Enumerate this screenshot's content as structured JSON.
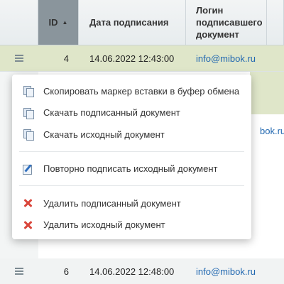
{
  "table": {
    "headers": {
      "id": "ID",
      "id_sort_icon": "sort-ascending-icon",
      "date": "Дата подписания",
      "login_line1": "Логин",
      "login_line2": "подписавшего",
      "login_line3": "документ"
    },
    "rows": [
      {
        "id": "4",
        "date": "14.06.2022 12:43:00",
        "login": "info@mibok.ru"
      },
      {
        "id": "",
        "date": "",
        "login": "bok.ru"
      },
      {
        "id": "6",
        "date": "14.06.2022 12:48:00",
        "login": "info@mibok.ru"
      }
    ]
  },
  "context_menu": {
    "items": [
      {
        "label": "Скопировать маркер вставки в буфер обмена",
        "icon": "copy-icon"
      },
      {
        "label": "Скачать подписанный документ",
        "icon": "copy-icon"
      },
      {
        "label": "Скачать исходный документ",
        "icon": "copy-icon"
      },
      {
        "label": "Повторно подписать исходный документ",
        "icon": "edit-icon"
      },
      {
        "label": "Удалить подписанный документ",
        "icon": "delete-icon"
      },
      {
        "label": "Удалить исходный документ",
        "icon": "delete-icon"
      }
    ]
  },
  "colors": {
    "selected_row": "#dfe6c9",
    "sorted_header": "#8a959c",
    "link": "#2067b0",
    "delete": "#d9453a"
  }
}
